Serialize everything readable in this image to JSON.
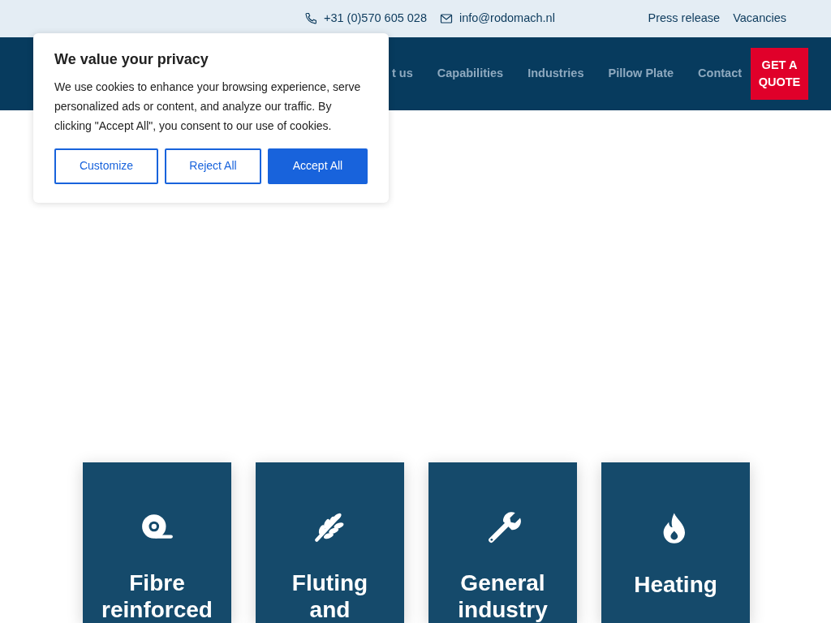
{
  "top_bar": {
    "phone": "+31 (0)570 605 028",
    "email": "info@rodomach.nl",
    "links": [
      "Press release",
      "Vacancies"
    ]
  },
  "nav": {
    "items": [
      "t us",
      "Capabilities",
      "Industries",
      "Pillow Plate",
      "Contact"
    ],
    "cta": "GET A QUOTE"
  },
  "cookie_banner": {
    "title": "We value your privacy",
    "text": "We use cookies to enhance your browsing experience, serve personalized ads or content, and analyze our traffic. By clicking \"Accept All\", you consent to our use of cookies.",
    "buttons": [
      {
        "label": "Customize",
        "kind": "outline"
      },
      {
        "label": "Reject All",
        "kind": "outline"
      },
      {
        "label": "Accept All",
        "kind": "primary"
      }
    ]
  },
  "industry_tiles": [
    {
      "title": "Fibre reinforced"
    },
    {
      "title": "Fluting and"
    },
    {
      "title": "General industry"
    },
    {
      "title": "Heating"
    }
  ]
}
